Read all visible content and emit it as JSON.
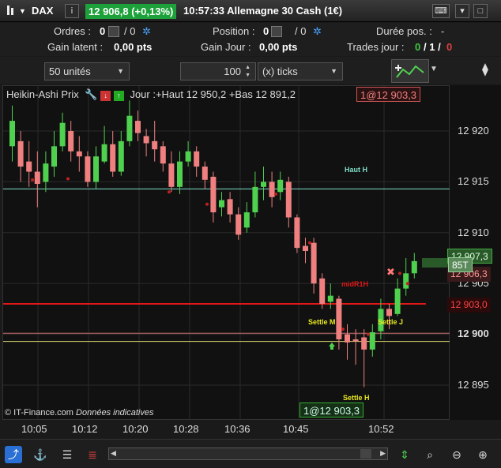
{
  "title": {
    "symbol": "DAX",
    "price": "12 906,8 (+0,13%)",
    "time_instrument": "10:57:33 Allemagne 30 Cash (1€)",
    "info_icon": "i"
  },
  "info": {
    "orders_label": "Ordres :",
    "orders_value": "0",
    "orders_value2": "/ 0",
    "position_label": "Position :",
    "position_value": "0",
    "position_value2": "/ 0",
    "duree_label": "Durée pos. :",
    "duree_value": "-",
    "gain_latent_label": "Gain latent :",
    "gain_latent_value": "0,00 pts",
    "gain_jour_label": "Gain Jour :",
    "gain_jour_value": "0,00 pts",
    "trades_label": "Trades jour :",
    "trades_a": "0",
    "trades_b": "/ 1 /",
    "trades_c": "0"
  },
  "toolbar": {
    "units": "50 unités",
    "quantity": "100",
    "ticks": "(x) ticks"
  },
  "chart": {
    "header_title": "Heikin-Ashi Prix",
    "header_info": "Jour :+Haut 12 950,2 +Bas 12 891,2",
    "top_badge": "1@12 903,3",
    "bottom_badge": "1@12 903,3",
    "copyright": "© IT-Finance.com",
    "copyright_note": "Données indicatives",
    "annotations": {
      "haut_h": "Haut H",
      "midr1h": "midR1H",
      "settle_m": "Settle M",
      "settle_j": "Settle J",
      "settle_h": "Settle H"
    },
    "price_labels": {
      "last": "12 907,3",
      "current": "12 906,3",
      "red_line": "12 903,0",
      "volume_tag": "85T"
    },
    "colors": {
      "bull": "#4fd14f",
      "bear": "#f08080",
      "red_line": "#e01818",
      "cyan_line": "#7fe0c8",
      "yellow_line": "#d8d870"
    }
  },
  "chart_data": {
    "type": "candlestick",
    "y_ticks": [
      "12 920",
      "12 915",
      "12 910",
      "12 905",
      "12 900",
      "12 895"
    ],
    "x_ticks": [
      "10:05",
      "10:12",
      "10:20",
      "10:28",
      "10:36",
      "10:45",
      "10:52"
    ],
    "ylim": [
      12893,
      12927
    ],
    "levels": {
      "haut_h": 12914.3,
      "midr1h": 12903.0,
      "settle": 12899.3,
      "settle_h": 12900.1
    }
  },
  "bottom": {
    "icons": [
      "share-icon",
      "anchor-icon",
      "list-icon",
      "ladder-icon",
      "scroll-left-icon",
      "scroll-right-icon",
      "autoscale-icon",
      "zoom-fit-icon",
      "zoom-out-icon",
      "zoom-in-icon"
    ]
  }
}
